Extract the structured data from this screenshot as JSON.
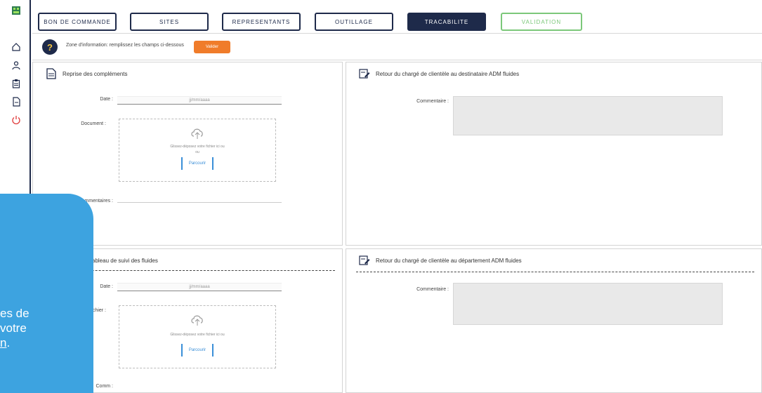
{
  "rail": {
    "icons": [
      "logo-icon",
      "home-icon",
      "user-icon",
      "clipboard-icon",
      "document-icon",
      "power-icon"
    ]
  },
  "tabs": [
    {
      "label": "BON DE COMMANDE",
      "state": "normal"
    },
    {
      "label": "SITES",
      "state": "normal"
    },
    {
      "label": "REPRESENTANTS",
      "state": "normal"
    },
    {
      "label": "OUTILLAGE",
      "state": "normal"
    },
    {
      "label": "TRACABILITE",
      "state": "active"
    },
    {
      "label": "VALIDATION",
      "state": "valid"
    }
  ],
  "info": {
    "text": "Zone d'information: remplissez les champs ci-dessous",
    "button": "Valider"
  },
  "panels": {
    "top_left": {
      "title": "Reprise des compléments",
      "date_label": "Date :",
      "date_value": "jj/mm/aaaa",
      "document_label": "Document :",
      "dropzone_text": "Glissez-déposez votre fichier ici ou",
      "dropzone_or": "ou",
      "browse_button": "Parcourir",
      "comment_label": "Commentaires :"
    },
    "top_right": {
      "title": "Retour du chargé de clientèle au destinataire ADM fluides",
      "comment_label": "Commentaire :"
    },
    "bottom_left": {
      "title": "Tableau de suivi des fluides",
      "date_label": "Date :",
      "date_value": "jj/mm/aaaa",
      "document_label": "Fichier :",
      "dropzone_text": "Glissez-déposez votre fichier ici ou",
      "browse_button": "Parcourir",
      "comment_label": "Comm :"
    },
    "bottom_right": {
      "title": "Retour du chargé de clientèle au département ADM fluides",
      "comment_label": "Commentaire :"
    }
  },
  "popup": {
    "line1": "es de",
    "line2": "votre",
    "line3": "n",
    "line3_end": "."
  },
  "colors": {
    "navy": "#1e2a4a",
    "orange": "#f07c2a",
    "green": "#7cc87a",
    "popup_blue": "#3da3e0",
    "link_blue": "#3a8fd8"
  }
}
